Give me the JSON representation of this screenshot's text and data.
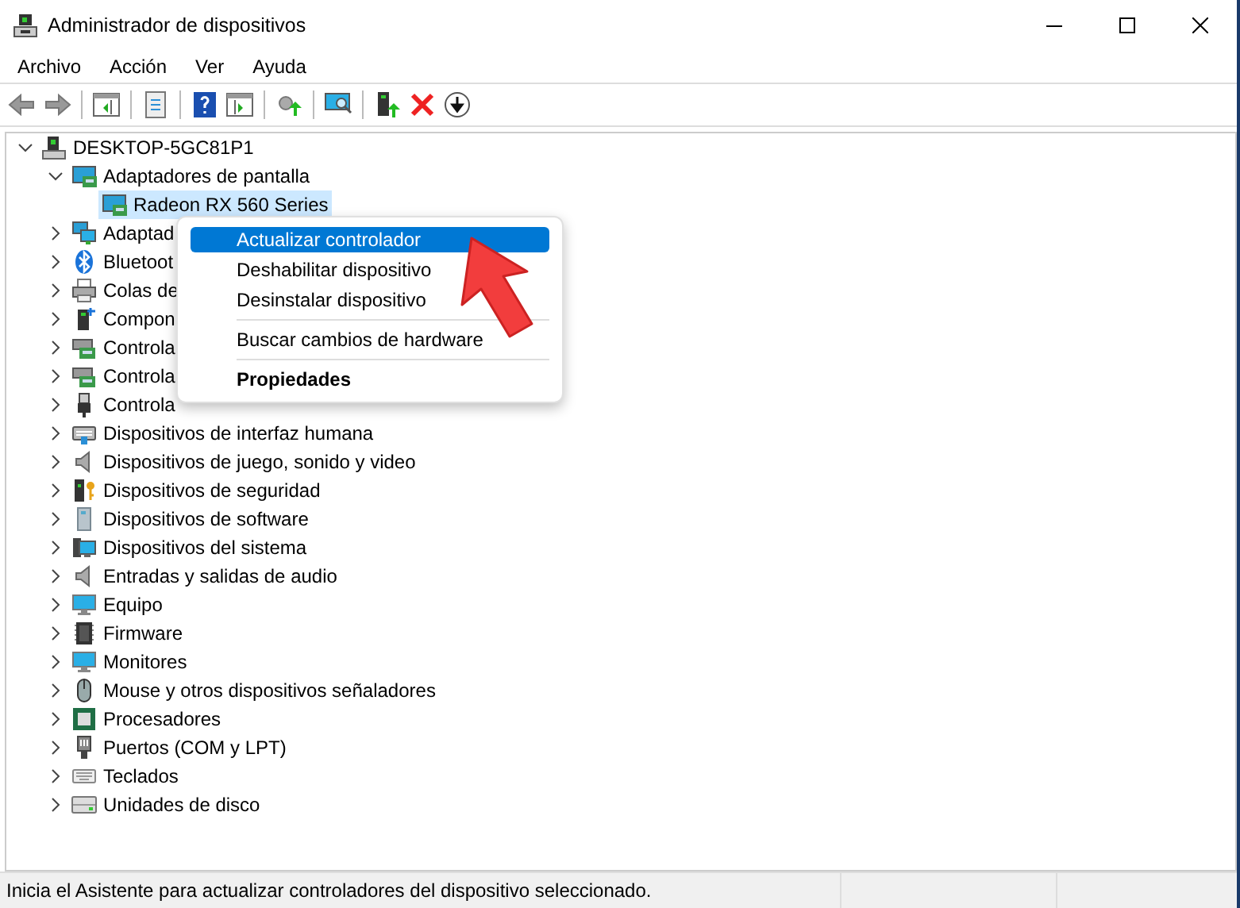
{
  "window": {
    "title": "Administrador de dispositivos"
  },
  "menu_bar": [
    {
      "label": "Archivo"
    },
    {
      "label": "Acción"
    },
    {
      "label": "Ver"
    },
    {
      "label": "Ayuda"
    }
  ],
  "tree": {
    "label": "DESKTOP-5GC81P1",
    "expanded": true,
    "selected": false,
    "children": [
      {
        "label": "Adaptadores de pantalla",
        "expanded": true,
        "selected": false,
        "children": [
          {
            "label": "Radeon RX 560 Series",
            "selected": true
          }
        ]
      },
      {
        "label": "Adaptad",
        "expanded": false,
        "selected": false
      },
      {
        "label": "Bluetoot",
        "expanded": false,
        "selected": false
      },
      {
        "label": "Colas de",
        "expanded": false,
        "selected": false
      },
      {
        "label": "Compon",
        "expanded": false,
        "selected": false
      },
      {
        "label": "Controla",
        "expanded": false,
        "selected": false
      },
      {
        "label": "Controla",
        "expanded": false,
        "selected": false
      },
      {
        "label": "Controla",
        "expanded": false,
        "selected": false
      },
      {
        "label": "Dispositivos de interfaz humana",
        "expanded": false,
        "selected": false
      },
      {
        "label": "Dispositivos de juego, sonido y video",
        "expanded": false,
        "selected": false
      },
      {
        "label": "Dispositivos de seguridad",
        "expanded": false,
        "selected": false
      },
      {
        "label": "Dispositivos de software",
        "expanded": false,
        "selected": false
      },
      {
        "label": "Dispositivos del sistema",
        "expanded": false,
        "selected": false
      },
      {
        "label": "Entradas y salidas de audio",
        "expanded": false,
        "selected": false
      },
      {
        "label": "Equipo",
        "expanded": false,
        "selected": false
      },
      {
        "label": "Firmware",
        "expanded": false,
        "selected": false
      },
      {
        "label": "Monitores",
        "expanded": false,
        "selected": false
      },
      {
        "label": "Mouse y otros dispositivos señaladores",
        "expanded": false,
        "selected": false
      },
      {
        "label": "Procesadores",
        "expanded": false,
        "selected": false
      },
      {
        "label": "Puertos (COM y LPT)",
        "expanded": false,
        "selected": false
      },
      {
        "label": "Teclados",
        "expanded": false,
        "selected": false
      },
      {
        "label": "Unidades de disco",
        "expanded": false,
        "selected": false
      }
    ]
  },
  "context_menu": [
    {
      "kind": "item",
      "label": "Actualizar controlador",
      "selected": true,
      "default": false
    },
    {
      "kind": "item",
      "label": "Deshabilitar dispositivo",
      "selected": false,
      "default": false
    },
    {
      "kind": "item",
      "label": "Desinstalar dispositivo",
      "selected": false,
      "default": false
    },
    {
      "kind": "separator"
    },
    {
      "kind": "item",
      "label": "Buscar cambios de hardware",
      "selected": false,
      "default": false
    },
    {
      "kind": "separator"
    },
    {
      "kind": "item",
      "label": "Propiedades",
      "selected": false,
      "default": true
    }
  ],
  "status_bar": {
    "text": "Inicia el Asistente para actualizar controladores del dispositivo seleccionado."
  }
}
